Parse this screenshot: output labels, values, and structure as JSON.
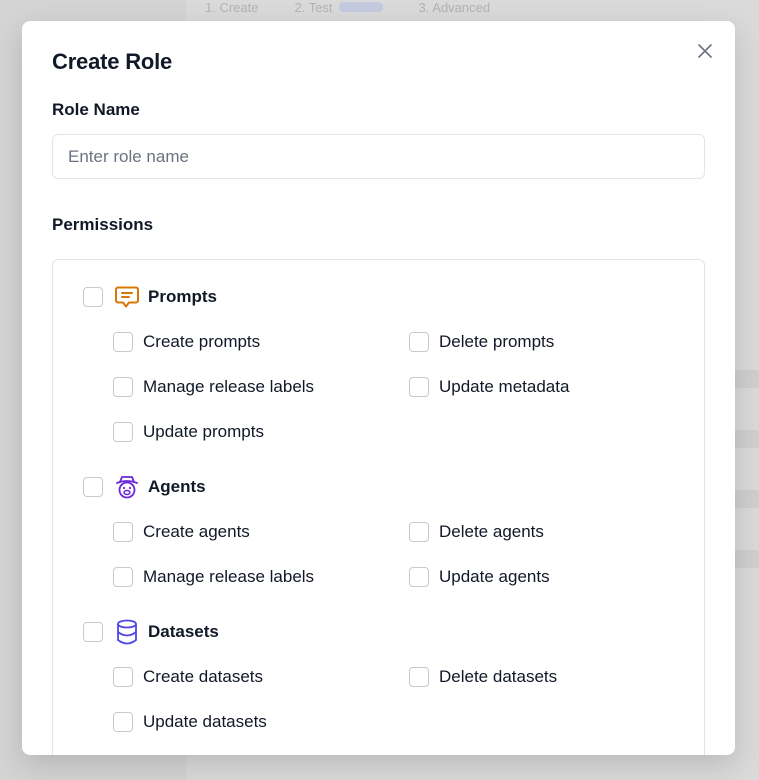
{
  "background": {
    "tabs": [
      "1. Create",
      "2. Test",
      "3. Advanced"
    ]
  },
  "dialog": {
    "title": "Create Role",
    "close_label": "×",
    "role_name": {
      "label": "Role Name",
      "value": "",
      "placeholder": "Enter role name"
    },
    "permissions_label": "Permissions",
    "groups": [
      {
        "label": "Prompts",
        "icon": "chat-icon",
        "color": "#d97706",
        "items": [
          "Create prompts",
          "Delete prompts",
          "Manage release labels",
          "Update metadata",
          "Update prompts"
        ]
      },
      {
        "label": "Agents",
        "icon": "agent-icon",
        "color": "#6d28d9",
        "items": [
          "Create agents",
          "Delete agents",
          "Manage release labels",
          "Update agents"
        ]
      },
      {
        "label": "Datasets",
        "icon": "database-icon",
        "color": "#4f46e5",
        "items": [
          "Create datasets",
          "Delete datasets",
          "Update datasets"
        ]
      }
    ]
  }
}
